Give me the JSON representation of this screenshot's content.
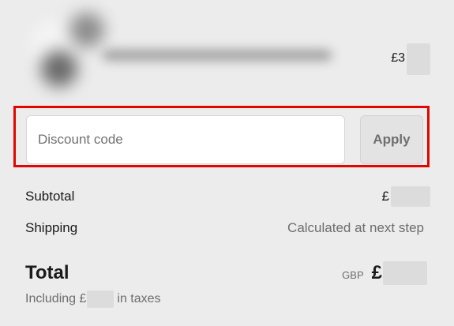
{
  "line_item": {
    "currency_symbol": "£3"
  },
  "discount": {
    "placeholder": "Discount code",
    "value": "",
    "apply_label": "Apply"
  },
  "summary": {
    "subtotal_label": "Subtotal",
    "subtotal_symbol": "£",
    "shipping_label": "Shipping",
    "shipping_value": "Calculated at next step",
    "total_label": "Total",
    "total_currency": "GBP",
    "total_symbol": "£",
    "taxes_prefix": "Including £",
    "taxes_suffix": "in taxes"
  },
  "colors": {
    "highlight_border": "#e10600",
    "apply_button_bg": "#e3e3e3",
    "page_bg": "#ececec"
  }
}
